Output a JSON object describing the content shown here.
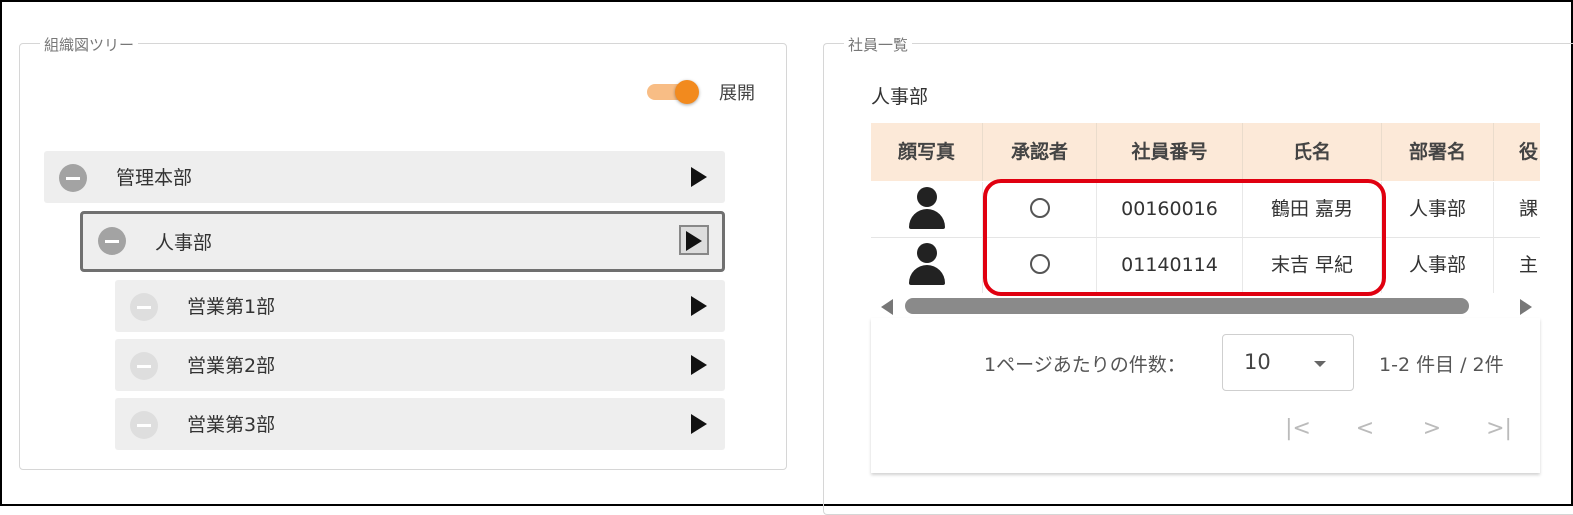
{
  "tree_panel": {
    "title": "組織図ツリー",
    "toggle_label": "展開",
    "nodes": [
      {
        "label": "管理本部"
      },
      {
        "label": "人事部"
      },
      {
        "label": "営業第1部"
      },
      {
        "label": "営業第2部"
      },
      {
        "label": "営業第3部"
      }
    ]
  },
  "list_panel": {
    "title": "社員一覧",
    "department": "人事部",
    "columns": [
      "顔写真",
      "承認者",
      "社員番号",
      "氏名",
      "部署名",
      "役"
    ],
    "rows": [
      {
        "employee_no": "00160016",
        "name": "鶴田 嘉男",
        "dept": "人事部",
        "role": "課"
      },
      {
        "employee_no": "01140114",
        "name": "末吉 早紀",
        "dept": "人事部",
        "role": "主"
      }
    ],
    "pagination": {
      "per_page_label": "1ページあたりの件数：",
      "per_page_value": "10",
      "range_text": "1-2 件目 / 2件",
      "first": "|<",
      "prev": "<",
      "next": ">",
      "last": ">|"
    }
  },
  "colors": {
    "accent": "#f28a1e",
    "header_bg": "#fce9d8",
    "highlight": "#e00010"
  }
}
